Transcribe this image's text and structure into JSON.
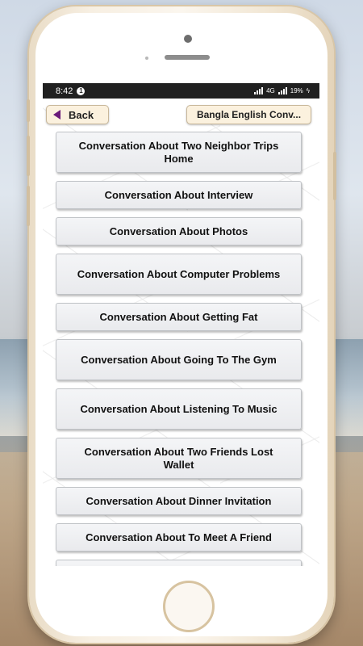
{
  "status_bar": {
    "time": "8:42",
    "notification_count": "1",
    "signal_label": "4G",
    "battery": "19%"
  },
  "header": {
    "back_label": "Back",
    "title": "Bangla English Conv..."
  },
  "conversations": [
    {
      "label": "Conversation About Two Neighbor Trips Home",
      "lines": 2
    },
    {
      "label": "Conversation About Interview",
      "lines": 1
    },
    {
      "label": "Conversation About Photos",
      "lines": 1
    },
    {
      "label": "Conversation About Computer Problems",
      "lines": 2
    },
    {
      "label": "Conversation About Getting Fat",
      "lines": 1
    },
    {
      "label": "Conversation About Going To The Gym",
      "lines": 2
    },
    {
      "label": "Conversation About Listening To Music",
      "lines": 2
    },
    {
      "label": "Conversation About Two Friends Lost Wallet",
      "lines": 2
    },
    {
      "label": "Conversation About Dinner Invitation",
      "lines": 1
    },
    {
      "label": "Conversation About To Meet A Friend",
      "lines": 1
    },
    {
      "label": "",
      "lines": 1
    }
  ]
}
